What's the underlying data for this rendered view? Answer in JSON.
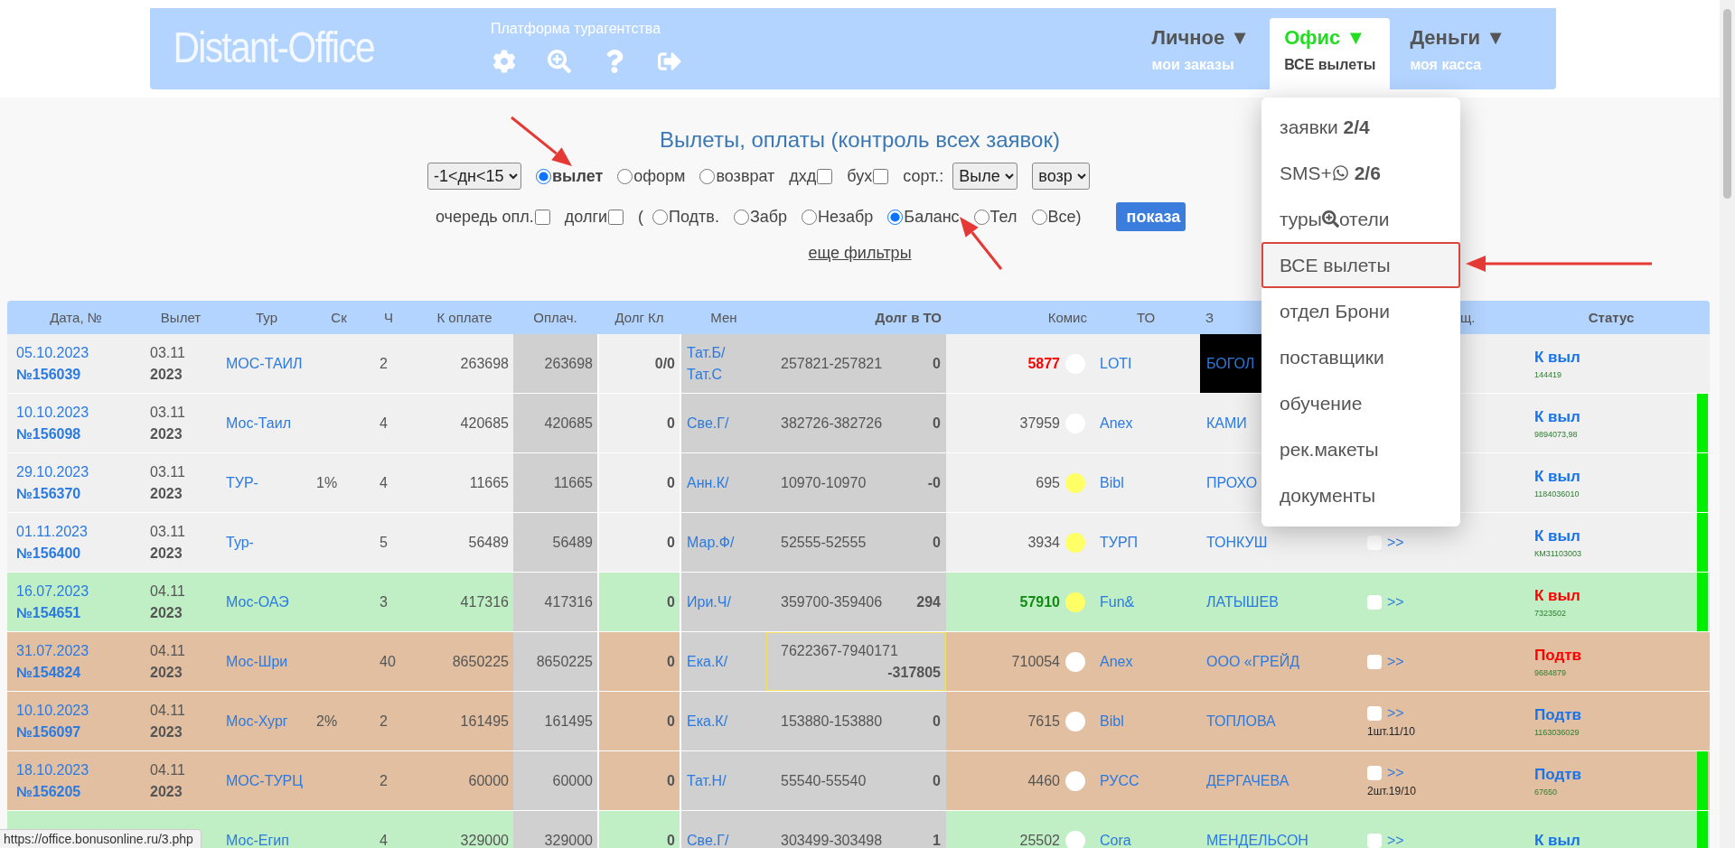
{
  "header": {
    "logo": "Distant-Office",
    "subtitle": "Платформа турагентства",
    "menus": [
      {
        "title": "Личное ▼",
        "sub": "мои заказы",
        "selected": false
      },
      {
        "title": "Офис ▼",
        "sub": "ВСЕ вылеты",
        "selected": true
      },
      {
        "title": "Деньги ▼",
        "sub": "моя касса",
        "selected": false
      }
    ]
  },
  "dropdown": [
    {
      "kind": "text",
      "label": "заявки",
      "count": "2/4",
      "selected": false
    },
    {
      "kind": "whatsapp",
      "label": "SMS+",
      "count": "2/6",
      "selected": false
    },
    {
      "kind": "search",
      "label": "туры",
      "tail": "отели",
      "selected": false
    },
    {
      "kind": "text",
      "label": "ВСЕ вылеты",
      "selected": true
    },
    {
      "kind": "text",
      "label": "отдел Брони",
      "selected": false
    },
    {
      "kind": "text",
      "label": "поставщики",
      "selected": false
    },
    {
      "kind": "text",
      "label": "обучение",
      "selected": false
    },
    {
      "kind": "text",
      "label": "рек.макеты",
      "selected": false
    },
    {
      "kind": "text",
      "label": "документы",
      "selected": false
    }
  ],
  "filters": {
    "title": "Вылеты, оплаты (контроль всех заявок)",
    "row1": [
      {
        "kind": "select",
        "value": "-1<дн<15"
      },
      {
        "kind": "radio",
        "label": "вылет",
        "selected": true,
        "strong": true
      },
      {
        "kind": "radio",
        "label": "оформ",
        "selected": false,
        "strong": false
      },
      {
        "kind": "radio",
        "label": "возврат",
        "selected": false,
        "strong": false
      },
      {
        "kind": "checkbox",
        "label": "дхд",
        "checked": false
      },
      {
        "kind": "checkbox",
        "label": "бух",
        "checked": false
      },
      {
        "kind": "text",
        "label": "сорт.:"
      },
      {
        "kind": "select",
        "value": "Выле"
      },
      {
        "kind": "select",
        "value": "возр"
      }
    ],
    "row2": [
      {
        "kind": "checkbox",
        "label": "очередь опл.",
        "checked": false
      },
      {
        "kind": "checkbox",
        "label": "долги",
        "checked": false
      },
      {
        "kind": "text",
        "label": "("
      },
      {
        "kind": "radio",
        "label": "Подтв.",
        "selected": false,
        "strong": false
      },
      {
        "kind": "radio",
        "label": "Забр",
        "selected": false,
        "strong": false
      },
      {
        "kind": "radio",
        "label": "Незабр",
        "selected": false,
        "strong": false
      },
      {
        "kind": "radio",
        "label": "Баланс",
        "selected": true,
        "strong": false
      },
      {
        "kind": "radio",
        "label": "Тел",
        "selected": false,
        "strong": false
      },
      {
        "kind": "radio",
        "label": "Все)",
        "selected": false,
        "strong": false
      },
      {
        "kind": "button",
        "label": "показа"
      }
    ],
    "more_link": "еще фильтры"
  },
  "table": {
    "columns": [
      {
        "label": "Дата, №",
        "strong": false
      },
      {
        "label": "Вылет",
        "strong": false
      },
      {
        "label": "Тур",
        "strong": false
      },
      {
        "label": "Ск",
        "strong": false
      },
      {
        "label": "Ч",
        "strong": false
      },
      {
        "label": "К оплате",
        "strong": false
      },
      {
        "label": "Оплач.",
        "strong": false
      },
      {
        "label": "Долг Кл",
        "strong": false
      },
      {
        "label": "Мен",
        "strong": false
      },
      {
        "label": "Долг в ТО",
        "strong": true
      },
      {
        "label": "Комис",
        "strong": false
      },
      {
        "label": "ТО",
        "strong": false
      },
      {
        "label": "З",
        "strong": false
      },
      {
        "label": "щ.",
        "strong": false
      },
      {
        "label": "Статус",
        "strong": true
      }
    ],
    "rows": [
      {
        "color": "#f0f0f0",
        "date": "05.10.2023",
        "number": "№156039",
        "day": "03.11",
        "year": "2023",
        "tour": "МОС-ТАИЛ",
        "pax": "2",
        "to_pay": "263698",
        "paid": "263698",
        "client_debt": "0/0",
        "manager": [
          "Тат.Б/",
          "Тат.С"
        ],
        "range": "257821-257821",
        "debt": "0",
        "debt_wrap": false,
        "commission": {
          "value": "5877",
          "kind": "alert"
        },
        "dot": {
          "color": "#ffffff"
        },
        "operator": "LOTI",
        "client": "БОГОЛ",
        "client_dark": true,
        "status": {
          "text": "К выл",
          "color": "#1a73e8"
        },
        "code": "144419",
        "flag": false
      },
      {
        "color": "#f0f0f0",
        "date": "10.10.2023",
        "number": "№156098",
        "day": "03.11",
        "year": "2023",
        "tour": "Мос-Таил",
        "pax": "4",
        "to_pay": "420685",
        "paid": "420685",
        "client_debt": "0",
        "manager": [
          "Све.Г/"
        ],
        "range": "382726-382726",
        "debt": "0",
        "debt_wrap": false,
        "commission": {
          "value": "37959",
          "kind": "plain"
        },
        "dot": {
          "color": "#ffffff"
        },
        "operator": "Anex",
        "client": "КАМИ",
        "client_dark": false,
        "status": {
          "text": "К выл",
          "color": "#1a73e8"
        },
        "code": "9894073,98",
        "flag": true
      },
      {
        "color": "#f0f0f0",
        "date": "29.10.2023",
        "number": "№156370",
        "day": "03.11",
        "year": "2023",
        "tour": "ТУР-",
        "discount": "1%",
        "pax": "4",
        "to_pay": "11665",
        "paid": "11665",
        "client_debt": "0",
        "manager": [
          "Анн.К/"
        ],
        "range": "10970-10970",
        "debt": "-0",
        "debt_wrap": false,
        "commission": {
          "value": "695",
          "kind": "plain"
        },
        "dot": {
          "color": "#ffff66"
        },
        "operator": "Bibl",
        "client": "ПРОХО",
        "client_dark": false,
        "status": {
          "text": "К выл",
          "color": "#1a73e8"
        },
        "code": "1184036010",
        "flag": true
      },
      {
        "color": "#f0f0f0",
        "date": "01.11.2023",
        "number": "№156400",
        "day": "03.11",
        "year": "2023",
        "tour": "Тур-",
        "pax": "5",
        "to_pay": "56489",
        "paid": "56489",
        "client_debt": "0",
        "manager": [
          "Мар.Ф/"
        ],
        "range": "52555-52555",
        "debt": "0",
        "debt_wrap": false,
        "commission": {
          "value": "3934",
          "kind": "plain"
        },
        "dot": {
          "color": "#ffff66"
        },
        "operator": "ТУРП",
        "client": "ТОНКУШ",
        "client_dark": false,
        "voucher": {
          "link": ">>"
        },
        "status": {
          "text": "К выл",
          "color": "#1a73e8"
        },
        "code": "КМ31103003",
        "flag": true
      },
      {
        "color": "#c0efc5",
        "date": "16.07.2023",
        "number": "№154651",
        "day": "04.11",
        "year": "2023",
        "tour": "Мос-ОАЭ",
        "pax": "3",
        "to_pay": "417316",
        "paid": "417316",
        "client_debt": "0",
        "manager": [
          "Ири.Ч/"
        ],
        "range": "359700-359406",
        "debt": "294",
        "debt_wrap": false,
        "commission": {
          "value": "57910",
          "kind": "good"
        },
        "dot": {
          "color": "#ffff66"
        },
        "operator": "Fun&",
        "client": "ЛАТЫШЕВ",
        "client_dark": false,
        "voucher": {
          "link": ">>"
        },
        "status": {
          "text": "К выл",
          "color": "#ff0000"
        },
        "code": "7323502",
        "flag": true
      },
      {
        "color": "#e2bfa0",
        "date": "31.07.2023",
        "number": "№154824",
        "day": "04.11",
        "year": "2023",
        "tour": "Мос-Шри",
        "pax": "40",
        "to_pay": "8650225",
        "paid": "8650225",
        "client_debt": "0",
        "manager": [
          "Ека.К/"
        ],
        "range": "7622367-7940171",
        "debt": "-317805",
        "debt_wrap": true,
        "commission": {
          "value": "710054",
          "kind": "plain"
        },
        "dot": {
          "color": "#ffffff"
        },
        "operator": "Anex",
        "client": "ООО «ГРЕЙД",
        "client_dark": false,
        "voucher": {
          "link": ">>"
        },
        "status": {
          "text": "Подтв",
          "color": "#ff0000"
        },
        "code": "9684879",
        "flag": false
      },
      {
        "color": "#e2bfa0",
        "date": "10.10.2023",
        "number": "№156097",
        "day": "04.11",
        "year": "2023",
        "tour": "Мос-Хург",
        "discount": "2%",
        "pax": "2",
        "to_pay": "161495",
        "paid": "161495",
        "client_debt": "0",
        "manager": [
          "Ека.К/"
        ],
        "range": "153880-153880",
        "debt": "0",
        "debt_wrap": false,
        "commission": {
          "value": "7615",
          "kind": "plain"
        },
        "dot": {
          "color": "#ffffff"
        },
        "operator": "Bibl",
        "client": "ТОПЛОВА",
        "client_dark": false,
        "voucher": {
          "link": ">>",
          "note": "1шт.11/10"
        },
        "status": {
          "text": "Подтв",
          "color": "#1a73e8"
        },
        "code": "1163036029",
        "flag": false
      },
      {
        "color": "#e2bfa0",
        "date": "18.10.2023",
        "number": "№156205",
        "day": "04.11",
        "year": "2023",
        "tour": "МОС-ТУРЦ",
        "pax": "2",
        "to_pay": "60000",
        "paid": "60000",
        "client_debt": "0",
        "manager": [
          "Тат.Н/"
        ],
        "range": "55540-55540",
        "debt": "0",
        "debt_wrap": false,
        "commission": {
          "value": "4460",
          "kind": "plain"
        },
        "dot": {
          "color": "#ffffff"
        },
        "operator": "РУСС",
        "client": "ДЕРГАЧЕВА",
        "client_dark": false,
        "voucher": {
          "link": ">>",
          "note": "2шт.19/10"
        },
        "status": {
          "text": "Подтв",
          "color": "#1a73e8"
        },
        "code": "67650",
        "flag": true
      },
      {
        "color": "#c0efc5",
        "tour": "Мос-Егип",
        "pax": "4",
        "to_pay": "329000",
        "paid": "329000",
        "client_debt": "0",
        "manager": [
          "Све.Г/"
        ],
        "range": "303499-303498",
        "debt": "1",
        "debt_wrap": false,
        "commission": {
          "value": "25502",
          "kind": "plain"
        },
        "dot": {
          "color": "#ffffff"
        },
        "operator": "Cora",
        "client": "МЕНДЕЛЬСОН",
        "client_dark": false,
        "voucher": {
          "link": ">>"
        },
        "status": {
          "text": "К выл",
          "color": "#1a73e8"
        },
        "flag": true
      }
    ]
  },
  "status_url": "https://office.bonusonline.ru/3.php"
}
